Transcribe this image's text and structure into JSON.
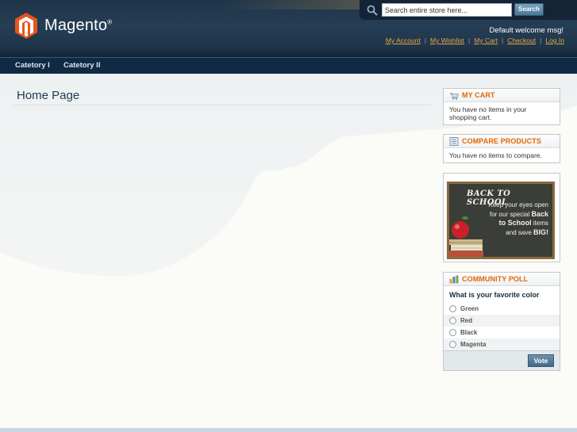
{
  "header": {
    "logo_text": "Magento",
    "logo_mark": "®",
    "search": {
      "placeholder": "Search entire store here...",
      "value": "Search entire store here...",
      "button_label": "Search"
    },
    "welcome": "Default welcome msg!",
    "links": [
      "My Account",
      "My Wishlist",
      "My Cart",
      "Checkout",
      "Log In"
    ],
    "link_separator": "|"
  },
  "nav": {
    "items": [
      "Catetory I",
      "Catetory II"
    ]
  },
  "main": {
    "title": "Home Page"
  },
  "sidebar": {
    "cart": {
      "title": "MY CART",
      "icon": "cart-icon",
      "body": "You have no items in your shopping cart."
    },
    "compare": {
      "title": "COMPARE PRODUCTS",
      "icon": "compare-list-icon",
      "body": "You have no items to compare."
    },
    "banner": {
      "title": "BACK TO SCHOOL",
      "line1": "Keep your eyes open",
      "line2": "for our special",
      "line2_bold": "Back",
      "line3_bold": "to School",
      "line3": "items",
      "line4": "and save",
      "line4_bold": "BIG!"
    },
    "poll": {
      "title": "COMMUNITY POLL",
      "icon": "poll-icon",
      "question": "What is your favorite color",
      "options": [
        "Green",
        "Red",
        "Black",
        "Magenta"
      ],
      "vote_label": "Vote"
    }
  },
  "colors": {
    "accent": "#e26703",
    "header_bg": "#1e3448",
    "nav_bg": "#0f2a42",
    "link": "#e3a845"
  }
}
